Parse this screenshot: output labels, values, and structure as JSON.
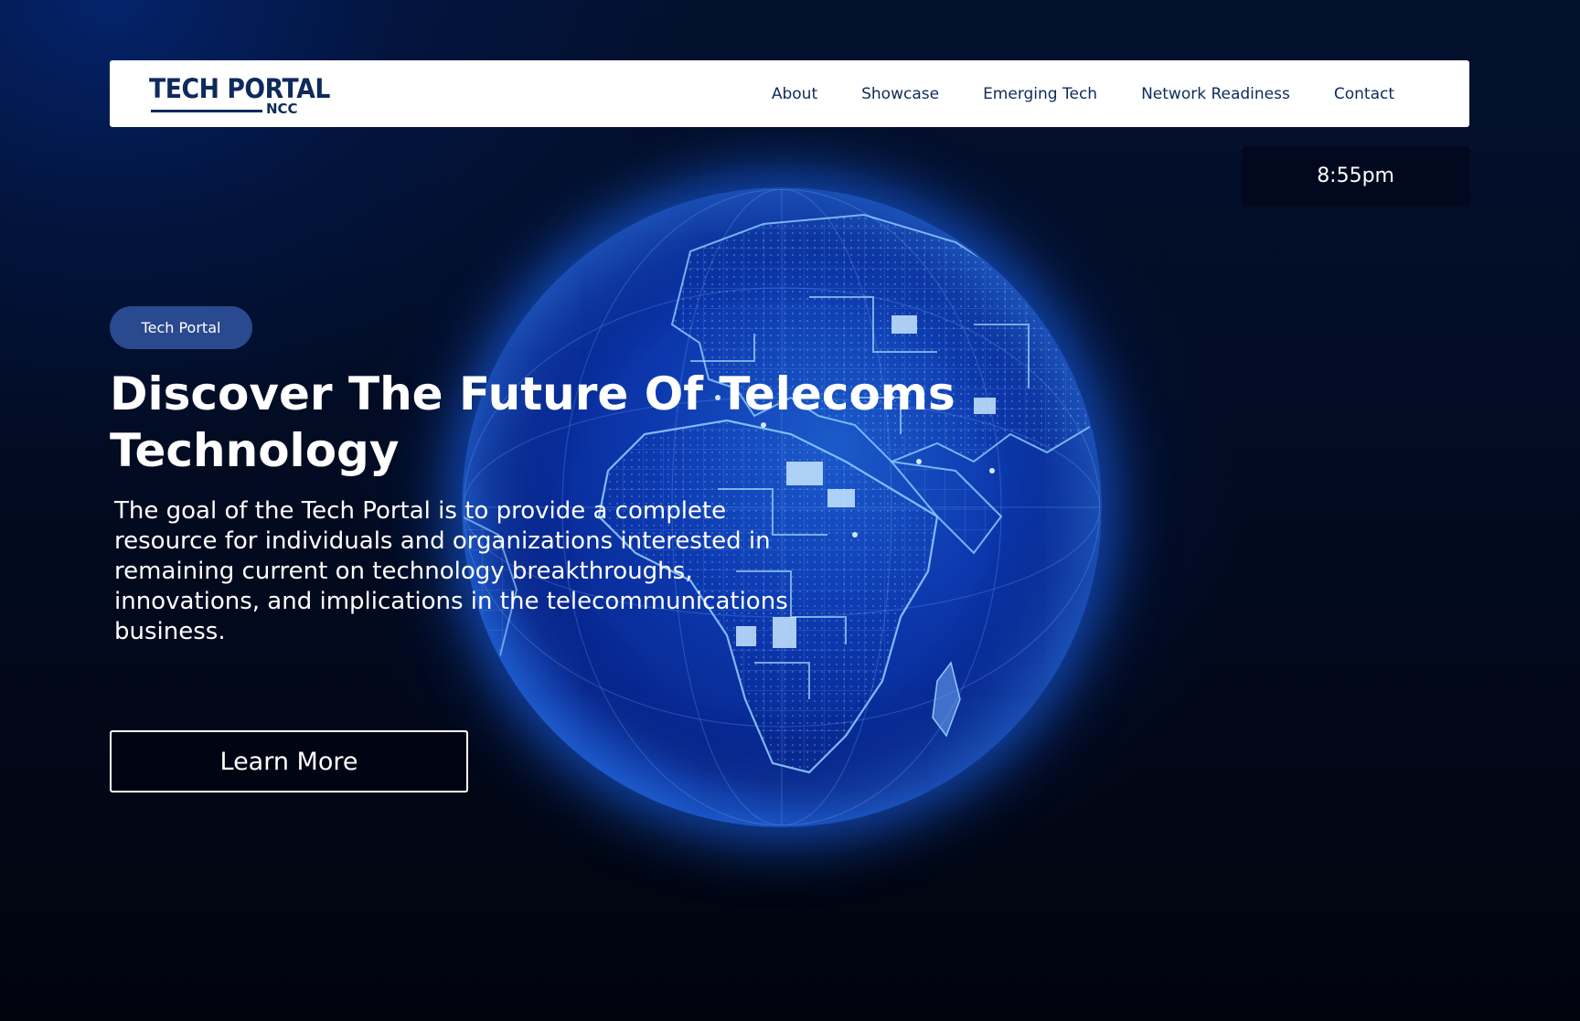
{
  "brand": {
    "logo_text": "TECH PORTAL",
    "logo_subtext": "NCC"
  },
  "nav": {
    "items": [
      {
        "label": "About"
      },
      {
        "label": "Showcase"
      },
      {
        "label": "Emerging Tech"
      },
      {
        "label": "Network Readiness"
      },
      {
        "label": "Contact"
      }
    ]
  },
  "clock": {
    "time": "8:55pm"
  },
  "hero": {
    "badge": "Tech Portal",
    "title": "Discover The Future Of Telecoms Technology",
    "description": "The goal of the Tech Portal is to provide a complete resource for individuals and organizations interested in remaining current on technology breakthroughs, innovations, and implications in the telecommunications business.",
    "cta_label": "Learn More"
  },
  "colors": {
    "navy": "#0f2a5c",
    "badge_bg": "#2a4a8f",
    "globe_blue": "#1e6eff",
    "background": "#020a1f"
  },
  "icons": {
    "logo_o_glyph": "globe-icon",
    "hero_image": "digital-globe-illustration"
  }
}
